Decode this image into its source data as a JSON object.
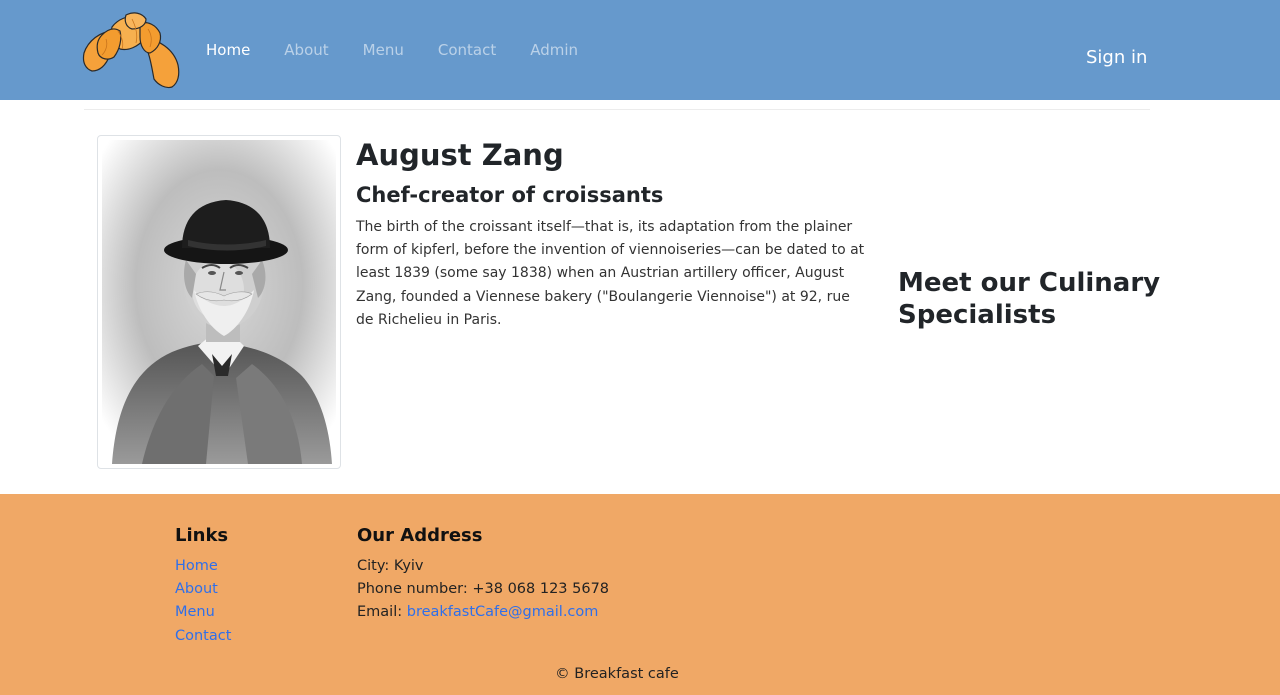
{
  "header": {
    "nav": [
      {
        "label": "Home",
        "active": true
      },
      {
        "label": "About",
        "active": false
      },
      {
        "label": "Menu",
        "active": false
      },
      {
        "label": "Contact",
        "active": false
      },
      {
        "label": "Admin",
        "active": false
      }
    ],
    "sign_in": "Sign in",
    "logo_icon": "croissant-icon"
  },
  "chef": {
    "name": "August Zang",
    "role": "Chef-creator of croissants",
    "bio": "The birth of the croissant itself—that is, its adaptation from the plainer form of kipferl, before the invention of viennoiseries—can be dated to at least 1839 (some say 1838) when an Austrian artillery officer, August Zang, founded a Viennese bakery (\"Boulangerie Viennoise\") at 92, rue de Richelieu in Paris."
  },
  "specialists_heading": "Meet our Culinary Specialists",
  "footer": {
    "links_heading": "Links",
    "links": [
      "Home",
      "About",
      "Menu",
      "Contact"
    ],
    "address_heading": "Our Address",
    "city": "City: Kyiv",
    "phone": "Phone number: +38 068 123 5678",
    "email_label": "Email: ",
    "email": "breakfastCafe@gmail.com",
    "copyright": "© Breakfast cafe"
  },
  "colors": {
    "header_bg": "#6699cc",
    "footer_bg": "#f0a866",
    "link": "#2f6fea",
    "croissant": "#f5a13a"
  }
}
